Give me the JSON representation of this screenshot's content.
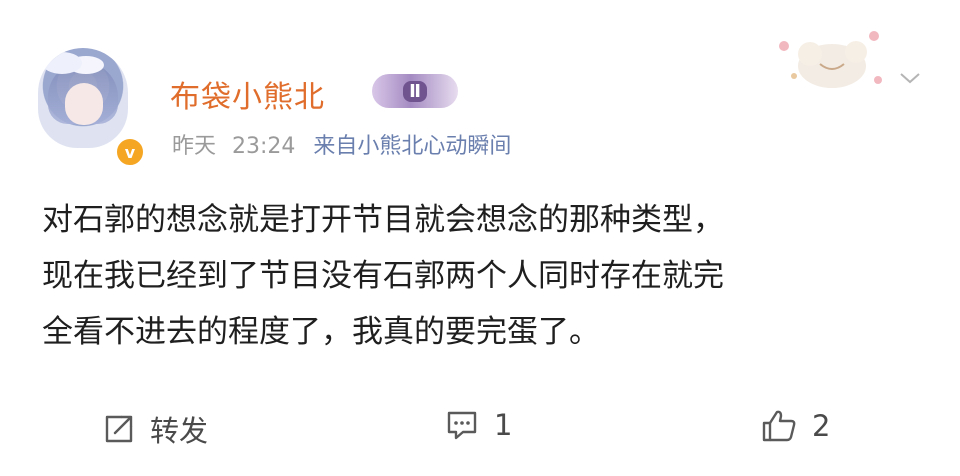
{
  "post": {
    "username": "布袋小熊北",
    "member_badge": "Ⅱ",
    "verified_mark": "v",
    "date": "昨天",
    "time": "23:24",
    "source": "来自小熊北心动瞬间",
    "text": "对石郭的想念就是打开节目就会想念的那种类型，\n现在我已经到了节目没有石郭两个人同时存在就完\n全看不进去的程度了，我真的要完蛋了。"
  },
  "actions": {
    "forward_label": "转发",
    "comment_count": "1",
    "like_count": "2"
  },
  "colors": {
    "username": "#e06d2b",
    "meta": "#9a9a9a",
    "verified": "#f5a623",
    "icon": "#5a5a5a"
  },
  "icons": {
    "forward": "forward-icon",
    "comment": "comment-icon",
    "like": "thumbs-up-icon",
    "more": "chevron-down-icon",
    "verified": "verified-badge-icon"
  }
}
